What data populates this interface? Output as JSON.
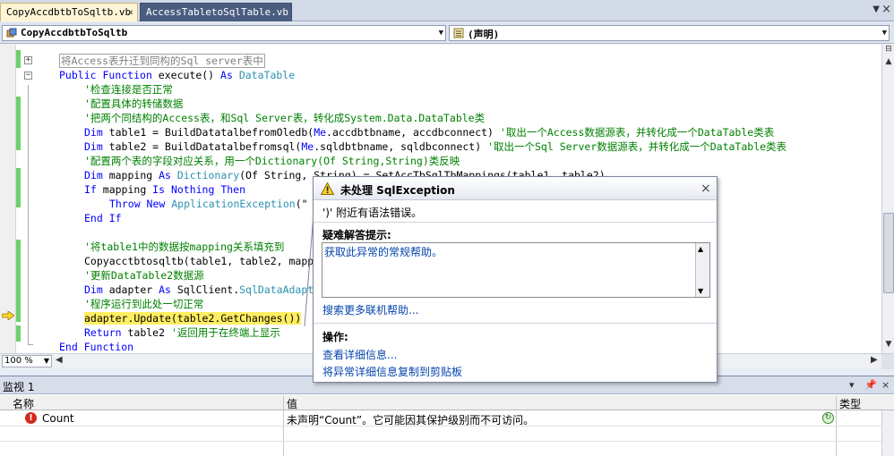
{
  "tabs": [
    {
      "label": "CopyAccdbtbToSqltb.vb",
      "active": true,
      "close": "×"
    },
    {
      "label": "AccessTabletoSqlTable.vb",
      "active": false
    }
  ],
  "tabstrip": {
    "dropdown_glyph": "▼",
    "close_glyph": "×"
  },
  "navbar": {
    "class_combo": "CopyAccdbtbToSqltb",
    "member_combo": "(声明)",
    "arrow": "▼"
  },
  "code": {
    "collapsed_region": "将Access表升迁到同构的Sql server表中",
    "outline_collapse": "−",
    "outline_expand": "+",
    "func_public": "Public",
    "func_function": "Function",
    "func_name": " execute() ",
    "func_as": "As",
    "func_type": " DataTable",
    "c1": "'检查连接是否正常",
    "c2": "'配置具体的转储数据",
    "c3": "'把两个同结构的Access表，和Sql Server表，转化成System.Data.DataTable类",
    "l_dim": "Dim",
    "l5_rest": " table1 = BuildDatatalbefromOledb(",
    "l_me": "Me",
    "l5_end": ".accdbtbname, accdbconnect) ",
    "c5": "'取出一个Access数据源表，并转化成一个DataTable类表",
    "l6_rest": " table2 = BuildDatatalbefromsql(",
    "l6_end": ".sqldbtbname, sqldbconnect) ",
    "c6": "'取出一个Sql Server数据源表，并转化成一个DataTable类表",
    "c7": "'配置两个表的字段对应关系，用一个Dictionary(Of String,String)类反映",
    "l8_a": " mapping ",
    "l_as": "As",
    "l8_type": " Dictionary",
    "l8_of": "(Of String, String) = SetAccTbSqlTbMappings(table1, table2)",
    "l9_if": "If",
    "l9_mid": " mapping ",
    "l9_is": "Is Nothing Then",
    "l10_throw": "Throw New",
    "l10_type": " ApplicationException",
    "l10_rest": "(\"",
    "l11": "End If",
    "c13": "'将table1中的数据按mapping关系填充到",
    "l14": "Copyacctbtosqltb(table1, table2, mapp",
    "c15": "'更新DataTable2数据源",
    "l16_a": " adapter ",
    "l16_b": " SqlClient.",
    "l16_type": "SqlDataAdapt",
    "c17": "'程序运行到此处一切正常",
    "l18": "adapter.Update(table2.GetChanges())",
    "l19_return": "Return",
    "l19_rest": " table2 ",
    "c19": "'返回用于在终端上显示",
    "l20": "End Function"
  },
  "scroll": {
    "up": "▲",
    "down": "▼",
    "left": "◀",
    "right": "▶",
    "split": "⊟"
  },
  "zoom": {
    "value": "100 %",
    "arrow": "▼"
  },
  "watch": {
    "title": "监视 1",
    "title_buttons": [
      "▾",
      "📌",
      "×"
    ],
    "columns": [
      "名称",
      "值",
      "类型"
    ],
    "rows": [
      {
        "name": "Count",
        "value": "未声明“Count”。它可能因其保护级别而不可访问。",
        "type": ""
      }
    ],
    "error_glyph": "!",
    "refresh_glyph": "↻"
  },
  "exception": {
    "heading": "未处理 SqlException",
    "close": "×",
    "message": "')' 附近有语法错误。",
    "tips_label": "疑难解答提示:",
    "tips_link": "获取此异常的常规帮助。",
    "more_help": "搜索更多联机帮助...",
    "actions_label": "操作:",
    "action_detail": "查看详细信息...",
    "action_copy": "将异常详细信息复制到剪贴板"
  },
  "colors": {
    "keyword": "#0000ff",
    "type": "#2b91af",
    "comment": "#008000",
    "highlight": "#ffee62",
    "changebar": "#6cd06c"
  }
}
